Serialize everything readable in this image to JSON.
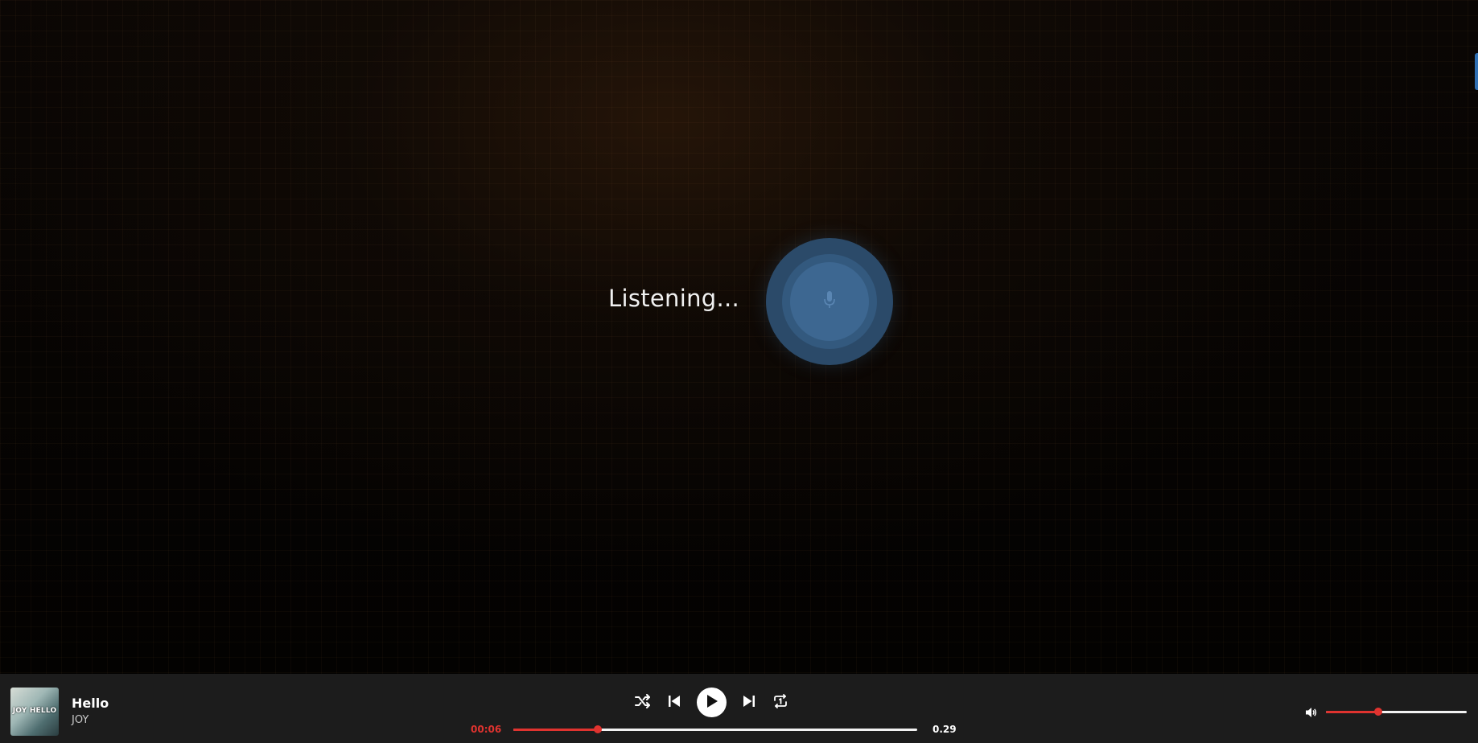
{
  "voice": {
    "status_text": "Listening..."
  },
  "player": {
    "track": {
      "title": "Hello",
      "artist": "JOY",
      "cover_text": "JOY HELLO"
    },
    "time_current": "00:06",
    "time_total": "0.29",
    "progress_fraction": 0.21,
    "volume_fraction": 0.37,
    "controls": [
      "shuffle-icon",
      "previous-icon",
      "play-icon",
      "next-icon",
      "repeat-one-icon"
    ]
  },
  "colors": {
    "accent": "#e0332f",
    "mic": "#3d6791",
    "player_bg": "#1c1c1c"
  }
}
